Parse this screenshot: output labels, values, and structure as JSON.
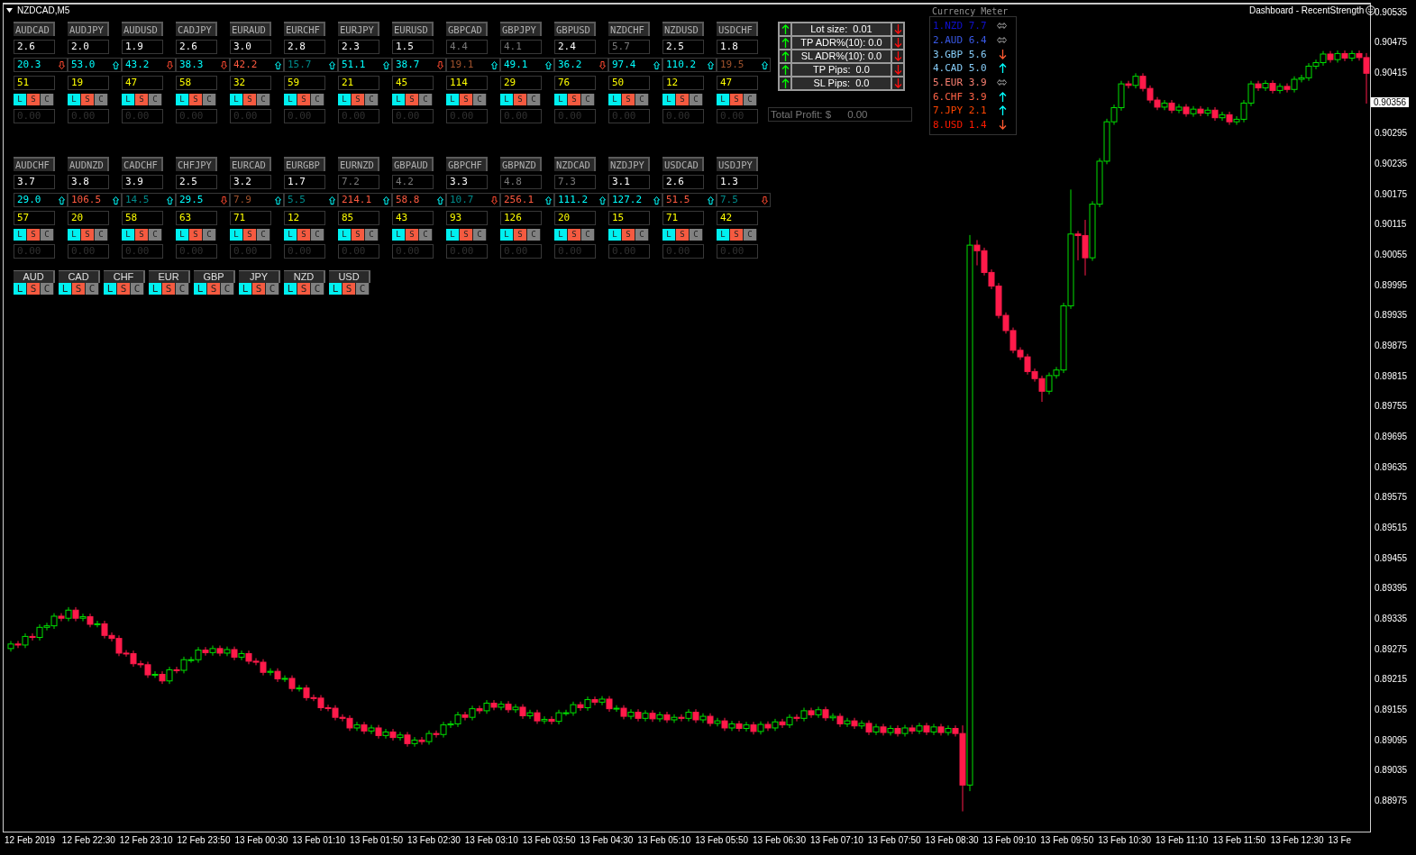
{
  "chart": {
    "symbol": "NZDCAD,M5",
    "indicator": "Dashboard - RecentStrength",
    "chart_data": {
      "type": "candlestick",
      "ylim": [
        0.8892,
        0.90556
      ],
      "yticks": [
        0.90535,
        0.90475,
        0.90415,
        0.90295,
        0.90235,
        0.90175,
        0.90115,
        0.90055,
        0.89995,
        0.89935,
        0.89875,
        0.89815,
        0.89755,
        0.89695,
        0.89635,
        0.89575,
        0.89515,
        0.89455,
        0.89395,
        0.89335,
        0.89275,
        0.89215,
        0.89155,
        0.89095,
        0.89035,
        0.88975
      ],
      "ohlc": [
        [
          0.89282,
          0.89297,
          0.89276,
          0.89291
        ],
        [
          0.89291,
          0.89297,
          0.89283,
          0.89289
        ],
        [
          0.89289,
          0.89312,
          0.89283,
          0.89306
        ],
        [
          0.89306,
          0.89312,
          0.89298,
          0.89304
        ],
        [
          0.89304,
          0.8933,
          0.89298,
          0.89324
        ],
        [
          0.89324,
          0.89333,
          0.89318,
          0.89327
        ],
        [
          0.89327,
          0.89352,
          0.89321,
          0.89346
        ],
        [
          0.89346,
          0.89352,
          0.89336,
          0.89342
        ],
        [
          0.89342,
          0.89364,
          0.89336,
          0.89358
        ],
        [
          0.89358,
          0.89364,
          0.89336,
          0.89342
        ],
        [
          0.89342,
          0.89351,
          0.89336,
          0.89345
        ],
        [
          0.89345,
          0.89351,
          0.89324,
          0.8933
        ],
        [
          0.8933,
          0.89337,
          0.89324,
          0.89331
        ],
        [
          0.89331,
          0.89337,
          0.89302,
          0.89308
        ],
        [
          0.89308,
          0.89314,
          0.89296,
          0.89302
        ],
        [
          0.89302,
          0.89308,
          0.89267,
          0.89273
        ],
        [
          0.89273,
          0.89279,
          0.89266,
          0.89272
        ],
        [
          0.89272,
          0.89278,
          0.89246,
          0.89252
        ],
        [
          0.89252,
          0.89258,
          0.89244,
          0.8925
        ],
        [
          0.8925,
          0.89256,
          0.89224,
          0.8923
        ],
        [
          0.8923,
          0.89237,
          0.89224,
          0.89231
        ],
        [
          0.89231,
          0.89237,
          0.89212,
          0.89218
        ],
        [
          0.89218,
          0.89246,
          0.89212,
          0.8924
        ],
        [
          0.8924,
          0.89246,
          0.89233,
          0.89239
        ],
        [
          0.89239,
          0.89266,
          0.89233,
          0.8926
        ],
        [
          0.8926,
          0.89266,
          0.89254,
          0.8926
        ],
        [
          0.8926,
          0.89285,
          0.89254,
          0.89279
        ],
        [
          0.89279,
          0.89285,
          0.89268,
          0.89274
        ],
        [
          0.89274,
          0.89288,
          0.89268,
          0.89282
        ],
        [
          0.89282,
          0.89288,
          0.89267,
          0.89273
        ],
        [
          0.89273,
          0.89286,
          0.89267,
          0.8928
        ],
        [
          0.8928,
          0.89286,
          0.89259,
          0.89265
        ],
        [
          0.89265,
          0.89278,
          0.89259,
          0.89272
        ],
        [
          0.89272,
          0.89278,
          0.89251,
          0.89257
        ],
        [
          0.89257,
          0.89263,
          0.89249,
          0.89255
        ],
        [
          0.89255,
          0.89261,
          0.89229,
          0.89235
        ],
        [
          0.89235,
          0.89243,
          0.89229,
          0.89237
        ],
        [
          0.89237,
          0.89243,
          0.89216,
          0.89222
        ],
        [
          0.89222,
          0.89229,
          0.89216,
          0.89223
        ],
        [
          0.89223,
          0.89229,
          0.89197,
          0.89203
        ],
        [
          0.89203,
          0.8921,
          0.89197,
          0.89204
        ],
        [
          0.89204,
          0.8921,
          0.89179,
          0.89185
        ],
        [
          0.89185,
          0.89191,
          0.89178,
          0.89184
        ],
        [
          0.89184,
          0.8919,
          0.89159,
          0.89165
        ],
        [
          0.89165,
          0.89171,
          0.89158,
          0.89164
        ],
        [
          0.89164,
          0.8917,
          0.8914,
          0.89146
        ],
        [
          0.89146,
          0.89152,
          0.89138,
          0.89144
        ],
        [
          0.89144,
          0.8915,
          0.89119,
          0.89125
        ],
        [
          0.89125,
          0.89137,
          0.89119,
          0.89131
        ],
        [
          0.89131,
          0.89137,
          0.89113,
          0.89119
        ],
        [
          0.89119,
          0.89131,
          0.89113,
          0.89125
        ],
        [
          0.89125,
          0.89131,
          0.89104,
          0.8911
        ],
        [
          0.8911,
          0.89123,
          0.89104,
          0.89117
        ],
        [
          0.89117,
          0.89123,
          0.891,
          0.89106
        ],
        [
          0.89106,
          0.89117,
          0.891,
          0.89111
        ],
        [
          0.89111,
          0.89117,
          0.89088,
          0.89094
        ],
        [
          0.89094,
          0.89107,
          0.89088,
          0.89101
        ],
        [
          0.89101,
          0.89107,
          0.89092,
          0.89098
        ],
        [
          0.89098,
          0.8912,
          0.89092,
          0.89114
        ],
        [
          0.89114,
          0.8912,
          0.89106,
          0.89112
        ],
        [
          0.89112,
          0.89137,
          0.89106,
          0.89131
        ],
        [
          0.89131,
          0.89139,
          0.89125,
          0.89133
        ],
        [
          0.89133,
          0.89157,
          0.89127,
          0.89151
        ],
        [
          0.89151,
          0.89157,
          0.8914,
          0.89146
        ],
        [
          0.89146,
          0.89169,
          0.8914,
          0.89163
        ],
        [
          0.89163,
          0.89169,
          0.89153,
          0.89159
        ],
        [
          0.89159,
          0.8918,
          0.89153,
          0.89174
        ],
        [
          0.89174,
          0.8918,
          0.8916,
          0.89166
        ],
        [
          0.89166,
          0.89178,
          0.8916,
          0.89172
        ],
        [
          0.89172,
          0.89178,
          0.89155,
          0.89161
        ],
        [
          0.89161,
          0.89172,
          0.89155,
          0.89166
        ],
        [
          0.89166,
          0.89172,
          0.89143,
          0.89149
        ],
        [
          0.89149,
          0.89161,
          0.89143,
          0.89155
        ],
        [
          0.89155,
          0.89161,
          0.89133,
          0.89139
        ],
        [
          0.89139,
          0.89148,
          0.89133,
          0.89142
        ],
        [
          0.89142,
          0.89148,
          0.89132,
          0.89138
        ],
        [
          0.89138,
          0.89161,
          0.89132,
          0.89155
        ],
        [
          0.89155,
          0.89161,
          0.89149,
          0.89155
        ],
        [
          0.89155,
          0.89177,
          0.89149,
          0.89171
        ],
        [
          0.89171,
          0.89177,
          0.89159,
          0.89165
        ],
        [
          0.89165,
          0.89187,
          0.89159,
          0.89181
        ],
        [
          0.89181,
          0.89187,
          0.8917,
          0.89176
        ],
        [
          0.89176,
          0.89188,
          0.8917,
          0.89182
        ],
        [
          0.89182,
          0.89188,
          0.89157,
          0.89163
        ],
        [
          0.89163,
          0.8917,
          0.89157,
          0.89164
        ],
        [
          0.89164,
          0.8917,
          0.89142,
          0.89148
        ],
        [
          0.89148,
          0.89162,
          0.89142,
          0.89156
        ],
        [
          0.89156,
          0.89162,
          0.89138,
          0.89144
        ],
        [
          0.89144,
          0.8916,
          0.89138,
          0.89154
        ],
        [
          0.89154,
          0.8916,
          0.89137,
          0.89143
        ],
        [
          0.89143,
          0.89157,
          0.89137,
          0.89151
        ],
        [
          0.89151,
          0.89157,
          0.89135,
          0.89141
        ],
        [
          0.89141,
          0.89152,
          0.89135,
          0.89146
        ],
        [
          0.89146,
          0.89152,
          0.89138,
          0.89144
        ],
        [
          0.89144,
          0.89162,
          0.89138,
          0.89156
        ],
        [
          0.89156,
          0.89162,
          0.89135,
          0.89141
        ],
        [
          0.89141,
          0.89154,
          0.89135,
          0.89148
        ],
        [
          0.89148,
          0.89154,
          0.89128,
          0.89134
        ],
        [
          0.89134,
          0.89145,
          0.89128,
          0.89139
        ],
        [
          0.89139,
          0.89145,
          0.89119,
          0.89125
        ],
        [
          0.89125,
          0.89139,
          0.89119,
          0.89133
        ],
        [
          0.89133,
          0.89139,
          0.89118,
          0.89124
        ],
        [
          0.89124,
          0.89137,
          0.89118,
          0.89131
        ],
        [
          0.89131,
          0.89137,
          0.89112,
          0.89118
        ],
        [
          0.89118,
          0.89138,
          0.89112,
          0.89132
        ],
        [
          0.89132,
          0.89138,
          0.89119,
          0.89125
        ],
        [
          0.89125,
          0.89143,
          0.89119,
          0.89137
        ],
        [
          0.89137,
          0.89143,
          0.89125,
          0.89131
        ],
        [
          0.89131,
          0.89152,
          0.89125,
          0.89146
        ],
        [
          0.89146,
          0.89152,
          0.89138,
          0.89144
        ],
        [
          0.89144,
          0.89165,
          0.89138,
          0.89159
        ],
        [
          0.89159,
          0.89165,
          0.89145,
          0.89151
        ],
        [
          0.89151,
          0.89167,
          0.89145,
          0.89161
        ],
        [
          0.89161,
          0.89167,
          0.89139,
          0.89145
        ],
        [
          0.89145,
          0.89154,
          0.89139,
          0.89148
        ],
        [
          0.89148,
          0.89154,
          0.89127,
          0.89133
        ],
        [
          0.89133,
          0.89145,
          0.89127,
          0.89139
        ],
        [
          0.89139,
          0.89145,
          0.89123,
          0.89129
        ],
        [
          0.89129,
          0.8914,
          0.89123,
          0.89134
        ],
        [
          0.89134,
          0.8914,
          0.89111,
          0.89117
        ],
        [
          0.89117,
          0.89133,
          0.89111,
          0.89127
        ],
        [
          0.89127,
          0.89133,
          0.8911,
          0.89116
        ],
        [
          0.89116,
          0.8913,
          0.8911,
          0.89124
        ],
        [
          0.89124,
          0.8913,
          0.89108,
          0.89114
        ],
        [
          0.89114,
          0.89131,
          0.89108,
          0.89125
        ],
        [
          0.89125,
          0.89131,
          0.89113,
          0.89119
        ],
        [
          0.89119,
          0.89135,
          0.89113,
          0.89129
        ],
        [
          0.89129,
          0.89135,
          0.89111,
          0.89117
        ],
        [
          0.89117,
          0.89133,
          0.89111,
          0.89127
        ],
        [
          0.89127,
          0.89133,
          0.8911,
          0.89116
        ],
        [
          0.89116,
          0.8913,
          0.8911,
          0.89124
        ],
        [
          0.89124,
          0.8913,
          0.89108,
          0.89114
        ],
        [
          0.89114,
          0.8913,
          0.8896,
          0.89012
        ],
        [
          0.89012,
          0.901,
          0.89,
          0.9008
        ],
        [
          0.9008,
          0.9009,
          0.9004,
          0.90069
        ],
        [
          0.90069,
          0.90075,
          0.9002,
          0.90026
        ],
        [
          0.90026,
          0.90032,
          0.89993,
          0.89999
        ],
        [
          0.89999,
          0.90005,
          0.89935,
          0.89941
        ],
        [
          0.89941,
          0.89947,
          0.89905,
          0.89911
        ],
        [
          0.89911,
          0.89917,
          0.89866,
          0.89872
        ],
        [
          0.89872,
          0.89878,
          0.89853,
          0.89859
        ],
        [
          0.89859,
          0.89865,
          0.89824,
          0.8983
        ],
        [
          0.8983,
          0.89836,
          0.8981,
          0.89816
        ],
        [
          0.89816,
          0.89822,
          0.8977,
          0.89791
        ],
        [
          0.89791,
          0.89828,
          0.89785,
          0.89822
        ],
        [
          0.89822,
          0.89839,
          0.89816,
          0.89833
        ],
        [
          0.89833,
          0.89966,
          0.89827,
          0.8996
        ],
        [
          0.8996,
          0.9019,
          0.89954,
          0.90102
        ],
        [
          0.90102,
          0.90108,
          0.9005,
          0.90099
        ],
        [
          0.90099,
          0.9013,
          0.9002,
          0.90055
        ],
        [
          0.90055,
          0.90167,
          0.90049,
          0.90161
        ],
        [
          0.90161,
          0.90252,
          0.90155,
          0.90246
        ],
        [
          0.90246,
          0.9033,
          0.9024,
          0.90324
        ],
        [
          0.90324,
          0.90358,
          0.90318,
          0.90352
        ],
        [
          0.90352,
          0.90405,
          0.90346,
          0.90399
        ],
        [
          0.90399,
          0.90405,
          0.9039,
          0.90396
        ],
        [
          0.90396,
          0.9042,
          0.9039,
          0.90414
        ],
        [
          0.90414,
          0.9042,
          0.90384,
          0.9039
        ],
        [
          0.9039,
          0.90396,
          0.90361,
          0.90367
        ],
        [
          0.90367,
          0.90373,
          0.90347,
          0.90353
        ],
        [
          0.90353,
          0.90367,
          0.90347,
          0.90361
        ],
        [
          0.90361,
          0.90367,
          0.90341,
          0.90347
        ],
        [
          0.90347,
          0.90359,
          0.90341,
          0.90353
        ],
        [
          0.90353,
          0.90359,
          0.90334,
          0.9034
        ],
        [
          0.9034,
          0.90355,
          0.90334,
          0.90349
        ],
        [
          0.90349,
          0.90355,
          0.90335,
          0.90341
        ],
        [
          0.90341,
          0.90353,
          0.90335,
          0.90347
        ],
        [
          0.90347,
          0.90353,
          0.90326,
          0.90332
        ],
        [
          0.90332,
          0.90344,
          0.90326,
          0.90338
        ],
        [
          0.90338,
          0.90344,
          0.90318,
          0.90324
        ],
        [
          0.90324,
          0.90335,
          0.90318,
          0.90329
        ],
        [
          0.90329,
          0.90367,
          0.90323,
          0.90361
        ],
        [
          0.90361,
          0.90405,
          0.90355,
          0.90399
        ],
        [
          0.90399,
          0.90405,
          0.90385,
          0.90391
        ],
        [
          0.90391,
          0.90406,
          0.90385,
          0.904
        ],
        [
          0.904,
          0.90406,
          0.9038,
          0.90386
        ],
        [
          0.90386,
          0.904,
          0.9038,
          0.90394
        ],
        [
          0.90394,
          0.904,
          0.90382,
          0.90388
        ],
        [
          0.90388,
          0.90414,
          0.90382,
          0.90408
        ],
        [
          0.90408,
          0.90417,
          0.90402,
          0.90411
        ],
        [
          0.90411,
          0.9044,
          0.90405,
          0.90434
        ],
        [
          0.90434,
          0.90447,
          0.90428,
          0.90441
        ],
        [
          0.90441,
          0.90464,
          0.90435,
          0.90458
        ],
        [
          0.90458,
          0.90464,
          0.90441,
          0.90447
        ],
        [
          0.90447,
          0.90465,
          0.90441,
          0.90459
        ],
        [
          0.90459,
          0.90465,
          0.90444,
          0.9045
        ],
        [
          0.9045,
          0.90465,
          0.90444,
          0.90459
        ],
        [
          0.90459,
          0.90465,
          0.90445,
          0.90451
        ],
        [
          0.90451,
          0.9046,
          0.9036,
          0.9042
        ]
      ]
    },
    "current_price": "0.90356",
    "time_labels": [
      "12 Feb 2019",
      "12 Feb 22:30",
      "12 Feb 23:10",
      "12 Feb 23:50",
      "13 Feb 00:30",
      "13 Feb 01:10",
      "13 Feb 01:50",
      "13 Feb 02:30",
      "13 Feb 03:10",
      "13 Feb 03:50",
      "13 Feb 04:30",
      "13 Feb 05:10",
      "13 Feb 05:50",
      "13 Feb 06:30",
      "13 Feb 07:10",
      "13 Feb 07:50",
      "13 Feb 08:30",
      "13 Feb 09:10",
      "13 Feb 09:50",
      "13 Feb 10:30",
      "13 Feb 11:10",
      "13 Feb 11:50",
      "13 Feb 12:30",
      "13 Fe"
    ]
  },
  "pair_grids": [
    {
      "tiles": [
        {
          "pair": "AUDCAD",
          "strength": "2.6",
          "dim": false,
          "adr": "20.3",
          "color": "#00ffff",
          "rising": false,
          "count": "51",
          "buttons": [
            "L",
            "S",
            "C"
          ],
          "profit": "0.00"
        },
        {
          "pair": "AUDJPY",
          "strength": "2.0",
          "dim": false,
          "adr": "53.0",
          "color": "#00ffff",
          "rising": true,
          "count": "19",
          "buttons": [
            "L",
            "S",
            "C"
          ],
          "profit": "0.00"
        },
        {
          "pair": "AUDUSD",
          "strength": "1.9",
          "dim": false,
          "adr": "43.2",
          "color": "#00ffff",
          "rising": false,
          "count": "47",
          "buttons": [
            "L",
            "S",
            "C"
          ],
          "profit": "0.00"
        },
        {
          "pair": "CADJPY",
          "strength": "2.6",
          "dim": false,
          "adr": "38.3",
          "color": "#00ffff",
          "rising": false,
          "count": "58",
          "buttons": [
            "L",
            "S",
            "C"
          ],
          "profit": "0.00"
        },
        {
          "pair": "EURAUD",
          "strength": "3.0",
          "dim": false,
          "adr": "42.2",
          "color": "#ff5a40",
          "rising": true,
          "count": "32",
          "buttons": [
            "L",
            "S",
            "C"
          ],
          "profit": "0.00"
        },
        {
          "pair": "EURCHF",
          "strength": "2.8",
          "dim": false,
          "adr": "15.7",
          "color": "#008b8b",
          "rising": true,
          "count": "59",
          "buttons": [
            "L",
            "S",
            "C"
          ],
          "profit": "0.00"
        },
        {
          "pair": "EURJPY",
          "strength": "2.3",
          "dim": false,
          "adr": "51.1",
          "color": "#00ffff",
          "rising": true,
          "count": "21",
          "buttons": [
            "L",
            "S",
            "C"
          ],
          "profit": "0.00"
        },
        {
          "pair": "EURUSD",
          "strength": "1.5",
          "dim": false,
          "adr": "38.7",
          "color": "#00ffff",
          "rising": false,
          "count": "45",
          "buttons": [
            "L",
            "S",
            "C"
          ],
          "profit": "0.00"
        },
        {
          "pair": "GBPCAD",
          "strength": "4.4",
          "dim": true,
          "adr": "19.1",
          "color": "#a0522d",
          "rising": true,
          "count": "114",
          "buttons": [
            "L",
            "S",
            "C"
          ],
          "profit": "0.00"
        },
        {
          "pair": "GBPJPY",
          "strength": "4.1",
          "dim": true,
          "adr": "49.1",
          "color": "#00ffff",
          "rising": true,
          "count": "29",
          "buttons": [
            "L",
            "S",
            "C"
          ],
          "profit": "0.00"
        },
        {
          "pair": "GBPUSD",
          "strength": "2.4",
          "dim": false,
          "adr": "36.2",
          "color": "#00ffff",
          "rising": false,
          "count": "76",
          "buttons": [
            "L",
            "S",
            "C"
          ],
          "profit": "0.00"
        },
        {
          "pair": "NZDCHF",
          "strength": "5.7",
          "dim": true,
          "adr": "97.4",
          "color": "#00ffff",
          "rising": true,
          "count": "50",
          "buttons": [
            "L",
            "S",
            "C"
          ],
          "profit": "0.00"
        },
        {
          "pair": "NZDUSD",
          "strength": "2.5",
          "dim": false,
          "adr": "110.2",
          "color": "#00ffff",
          "rising": true,
          "count": "12",
          "buttons": [
            "L",
            "S",
            "C"
          ],
          "profit": "0.00"
        },
        {
          "pair": "USDCHF",
          "strength": "1.8",
          "dim": false,
          "adr": "19.5",
          "color": "#a0522d",
          "rising": true,
          "count": "47",
          "buttons": [
            "L",
            "S",
            "C"
          ],
          "profit": "0.00"
        }
      ]
    },
    {
      "tiles": [
        {
          "pair": "AUDCHF",
          "strength": "3.7",
          "dim": false,
          "adr": "29.0",
          "color": "#00ffff",
          "rising": true,
          "count": "57",
          "buttons": [
            "L",
            "S",
            "C"
          ],
          "profit": "0.00"
        },
        {
          "pair": "AUDNZD",
          "strength": "3.8",
          "dim": false,
          "adr": "106.5",
          "color": "#ff5a40",
          "rising": true,
          "count": "20",
          "buttons": [
            "L",
            "S",
            "C"
          ],
          "profit": "0.00"
        },
        {
          "pair": "CADCHF",
          "strength": "3.9",
          "dim": false,
          "adr": "14.5",
          "color": "#008b8b",
          "rising": true,
          "count": "58",
          "buttons": [
            "L",
            "S",
            "C"
          ],
          "profit": "0.00"
        },
        {
          "pair": "CHFJPY",
          "strength": "2.5",
          "dim": false,
          "adr": "29.5",
          "color": "#00ffff",
          "rising": false,
          "count": "63",
          "buttons": [
            "L",
            "S",
            "C"
          ],
          "profit": "0.00"
        },
        {
          "pair": "EURCAD",
          "strength": "3.2",
          "dim": false,
          "adr": "7.9",
          "color": "#a0522d",
          "rising": true,
          "count": "71",
          "buttons": [
            "L",
            "S",
            "C"
          ],
          "profit": "0.00"
        },
        {
          "pair": "EURGBP",
          "strength": "1.7",
          "dim": false,
          "adr": "5.5",
          "color": "#008b8b",
          "rising": true,
          "count": "12",
          "buttons": [
            "L",
            "S",
            "C"
          ],
          "profit": "0.00"
        },
        {
          "pair": "EURNZD",
          "strength": "7.2",
          "dim": true,
          "adr": "214.1",
          "color": "#ff5a40",
          "rising": true,
          "count": "85",
          "buttons": [
            "L",
            "S",
            "C"
          ],
          "profit": "0.00"
        },
        {
          "pair": "GBPAUD",
          "strength": "4.2",
          "dim": true,
          "adr": "58.8",
          "color": "#ff5a40",
          "rising": true,
          "count": "43",
          "buttons": [
            "L",
            "S",
            "C"
          ],
          "profit": "0.00"
        },
        {
          "pair": "GBPCHF",
          "strength": "3.3",
          "dim": false,
          "adr": "10.7",
          "color": "#008b8b",
          "rising": false,
          "count": "93",
          "buttons": [
            "L",
            "S",
            "C"
          ],
          "profit": "0.00"
        },
        {
          "pair": "GBPNZD",
          "strength": "4.8",
          "dim": true,
          "adr": "256.1",
          "color": "#ff5a40",
          "rising": true,
          "count": "126",
          "buttons": [
            "L",
            "S",
            "C"
          ],
          "profit": "0.00"
        },
        {
          "pair": "NZDCAD",
          "strength": "7.3",
          "dim": true,
          "adr": "111.2",
          "color": "#00ffff",
          "rising": true,
          "count": "20",
          "buttons": [
            "L",
            "S",
            "C"
          ],
          "profit": "0.00"
        },
        {
          "pair": "NZDJPY",
          "strength": "3.1",
          "dim": false,
          "adr": "127.2",
          "color": "#00ffff",
          "rising": true,
          "count": "15",
          "buttons": [
            "L",
            "S",
            "C"
          ],
          "profit": "0.00"
        },
        {
          "pair": "USDCAD",
          "strength": "2.6",
          "dim": false,
          "adr": "51.5",
          "color": "#ff5a40",
          "rising": true,
          "count": "71",
          "buttons": [
            "L",
            "S",
            "C"
          ],
          "profit": "0.00"
        },
        {
          "pair": "USDJPY",
          "strength": "1.3",
          "dim": false,
          "adr": "7.5",
          "color": "#008b8b",
          "rising": false,
          "count": "42",
          "buttons": [
            "L",
            "S",
            "C"
          ],
          "profit": "0.00"
        }
      ]
    }
  ],
  "currencies": [
    {
      "code": "AUD",
      "buttons": [
        "L",
        "S",
        "C"
      ]
    },
    {
      "code": "CAD",
      "buttons": [
        "L",
        "S",
        "C"
      ]
    },
    {
      "code": "CHF",
      "buttons": [
        "L",
        "S",
        "C"
      ]
    },
    {
      "code": "EUR",
      "buttons": [
        "L",
        "S",
        "C"
      ]
    },
    {
      "code": "GBP",
      "buttons": [
        "L",
        "S",
        "C"
      ]
    },
    {
      "code": "JPY",
      "buttons": [
        "L",
        "S",
        "C"
      ]
    },
    {
      "code": "NZD",
      "buttons": [
        "L",
        "S",
        "C"
      ]
    },
    {
      "code": "USD",
      "buttons": [
        "L",
        "S",
        "C"
      ]
    }
  ],
  "trade_panel": {
    "rows": [
      "Lot size:  0.01",
      "TP ADR%(10): 0.0",
      "SL ADR%(10): 0.0",
      "TP Pips:  0.0",
      "SL Pips:  0.0"
    ],
    "total_profit": {
      "label": "Total Profit: $",
      "value": "0.00"
    }
  },
  "currency_meter": {
    "title": "Currency Meter",
    "items": [
      {
        "text": "1.NZD 7.7",
        "color": "#1010d0",
        "kind": "flat"
      },
      {
        "text": "2.AUD 6.4",
        "color": "#3a5ae8",
        "kind": "flat"
      },
      {
        "text": "3.GBP 5.6",
        "color": "#87cefa",
        "kind": "down"
      },
      {
        "text": "4.CAD 5.0",
        "color": "#87cefa",
        "kind": "up"
      },
      {
        "text": "5.EUR 3.9",
        "color": "#fa8072",
        "kind": "flat"
      },
      {
        "text": "6.CHF 3.9",
        "color": "#ff6347",
        "kind": "up"
      },
      {
        "text": "7.JPY 2.1",
        "color": "#ff4500",
        "kind": "up"
      },
      {
        "text": "8.USD 1.4",
        "color": "#ff1a00",
        "kind": "down"
      }
    ]
  }
}
